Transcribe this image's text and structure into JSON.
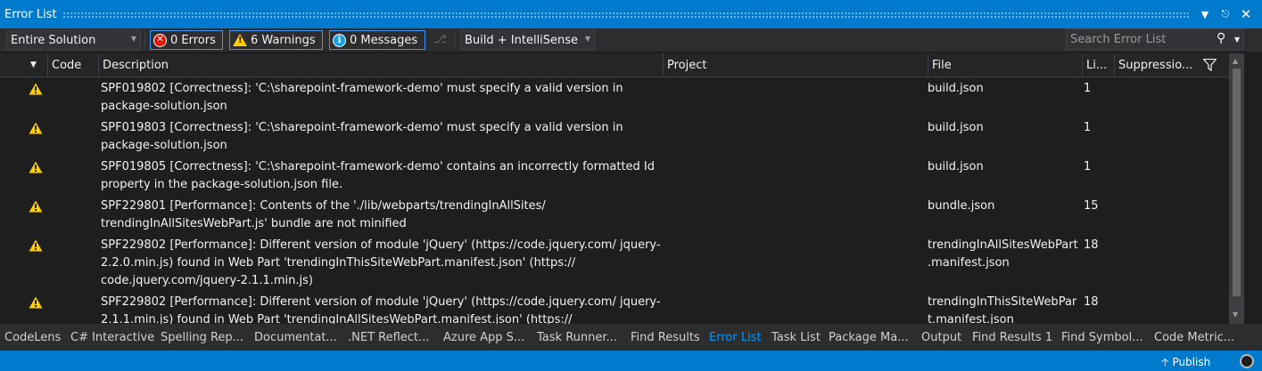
{
  "window": {
    "title": "Error List",
    "buttons": [
      "dropdown",
      "pin",
      "close"
    ]
  },
  "toolbar": {
    "scope_value": "Entire Solution",
    "errors_label": "0 Errors",
    "warnings_label": "6 Warnings",
    "messages_label": "0 Messages",
    "build_value": "Build + IntelliSense",
    "search_placeholder": "Search Error List",
    "filter_icon_glyph": "▼"
  },
  "columns": {
    "code": "Code",
    "description": "Description",
    "project": "Project",
    "file": "File",
    "line": "Li...",
    "suppression": "Suppressio..."
  },
  "rows": [
    {
      "severity": "warning",
      "description": "SPF019802 [Correctness]: 'C:\\sharepoint-framework-demo' must specify a valid version in package-solution.json",
      "file": "build.json",
      "line": "1"
    },
    {
      "severity": "warning",
      "description": "SPF019803 [Correctness]: 'C:\\sharepoint-framework-demo' must specify a valid version in package-solution.json",
      "file": "build.json",
      "line": "1"
    },
    {
      "severity": "warning",
      "description": "SPF019805 [Correctness]: 'C:\\sharepoint-framework-demo' contains an incorrectly formatted Id property in the package-solution.json file.",
      "file": "build.json",
      "line": "1"
    },
    {
      "severity": "warning",
      "description": "SPF229801 [Performance]: Contents of the './lib/webparts/trendingInAllSites/ trendingInAllSitesWebPart.js' bundle are not minified",
      "file": "bundle.json",
      "line": "15"
    },
    {
      "severity": "warning",
      "description": "SPF229802 [Performance]: Different version of module 'jQuery' (https://code.jquery.com/ jquery-2.2.0.min.js) found in Web Part 'trendingInThisSiteWebPart.manifest.json' (https:// code.jquery.com/jquery-2.1.1.min.js)",
      "file": "trendingInAllSitesWebPart .manifest.json",
      "line": "18"
    },
    {
      "severity": "warning",
      "description": "SPF229802 [Performance]: Different version of module 'jQuery' (https://code.jquery.com/ jquery-2.1.1.min.js) found in Web Part 'trendingInAllSitesWebPart.manifest.json' (https://",
      "file": "trendingInThisSiteWebPar t.manifest.json",
      "line": "18"
    }
  ],
  "tabs": [
    "CodeLens",
    "C# Interactive",
    "Spelling Rep...",
    "Documentat...",
    ".NET Reflect...",
    "Azure App S...",
    "Task Runner...",
    "Find Results",
    "Error List",
    "Task List",
    "Package Ma...",
    "Output",
    "Find Results 1",
    "Find Symbol...",
    "Code Metric..."
  ],
  "active_tab": "Error List",
  "status": {
    "publish_label": "Publish"
  },
  "colors": {
    "accent": "#007acc",
    "warning": "#ffcc00",
    "active_tab": "#0097fb"
  }
}
